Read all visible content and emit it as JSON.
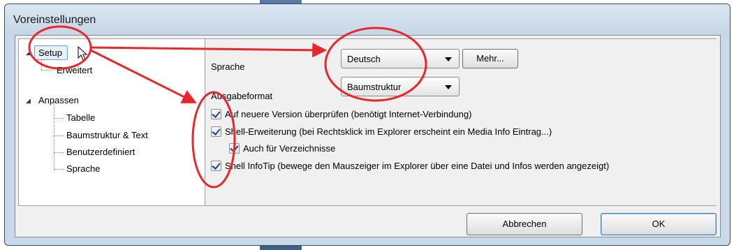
{
  "window": {
    "title": "Voreinstellungen"
  },
  "tree": {
    "items": [
      {
        "label": "Setup",
        "expanded": true,
        "selected": true
      },
      {
        "label": "Erweitert"
      },
      {
        "label": "Anpassen",
        "expanded": true
      },
      {
        "label": "Tabelle"
      },
      {
        "label": "Baumstruktur & Text"
      },
      {
        "label": "Benutzerdefiniert"
      },
      {
        "label": "Sprache"
      }
    ]
  },
  "settings": {
    "language_label": "Sprache",
    "language_value": "Deutsch",
    "more_button": "Mehr...",
    "output_label": "Ausgabeformat",
    "output_value": "Baumstruktur",
    "checkboxes": [
      {
        "label": "Auf neuere Version überprüfen (benötigt Internet-Verbindung)",
        "checked": true
      },
      {
        "label": "Shell-Erweiterung (bei Rechtsklick im Explorer erscheint ein Media Info Eintrag...)",
        "checked": true
      },
      {
        "label": "Auch für Verzeichnisse",
        "checked": true
      },
      {
        "label": "Shell InfoTip (bewege den Mauszeiger im Explorer über eine Datei und Infos werden angezeigt)",
        "checked": true
      }
    ]
  },
  "footer": {
    "cancel_button": "Abbrechen",
    "ok_button": "OK"
  },
  "annotation_color": "#e8262b"
}
